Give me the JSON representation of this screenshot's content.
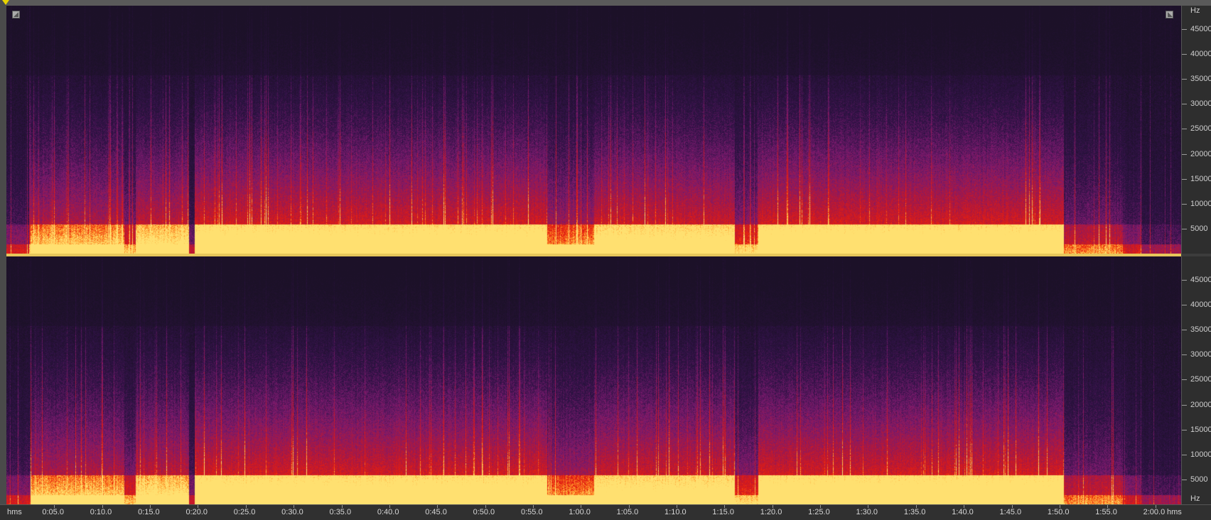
{
  "window": {
    "marker_color": "#e8d400"
  },
  "frequency_axis": {
    "unit": "Hz",
    "top_channel_labels": [
      "45000",
      "40000",
      "35000",
      "30000",
      "25000",
      "20000",
      "15000",
      "10000",
      "5000"
    ],
    "bottom_channel_labels": [
      "45000",
      "40000",
      "35000",
      "30000",
      "25000",
      "20000",
      "15000",
      "10000",
      "5000"
    ],
    "values": [
      45000,
      40000,
      35000,
      30000,
      25000,
      20000,
      15000,
      10000,
      5000
    ],
    "max_hz": 48000
  },
  "time_axis": {
    "unit": "hms",
    "labels": [
      "0:05.0",
      "0:10.0",
      "0:15.0",
      "0:20.0",
      "0:25.0",
      "0:30.0",
      "0:35.0",
      "0:40.0",
      "0:45.0",
      "0:50.0",
      "0:55.0",
      "1:00.0",
      "1:05.0",
      "1:10.0",
      "1:15.0",
      "1:20.0",
      "1:25.0",
      "1:30.0",
      "1:35.0",
      "1:40.0",
      "1:45.0",
      "1:50.0",
      "1:55.0",
      "2:00.0"
    ],
    "seconds": [
      5,
      10,
      15,
      20,
      25,
      30,
      35,
      40,
      45,
      50,
      55,
      60,
      65,
      70,
      75,
      80,
      85,
      90,
      95,
      100,
      105,
      110,
      115,
      120
    ],
    "total_seconds": 122.7
  },
  "colors": {
    "low": "#1c1128",
    "mid": "#7a1a6e",
    "high": "#e8200e",
    "peak": "#ffe070",
    "divider": "#e6c65a"
  },
  "channels": [
    {
      "name": "spectrogram-channel-1"
    },
    {
      "name": "spectrogram-channel-2"
    }
  ]
}
